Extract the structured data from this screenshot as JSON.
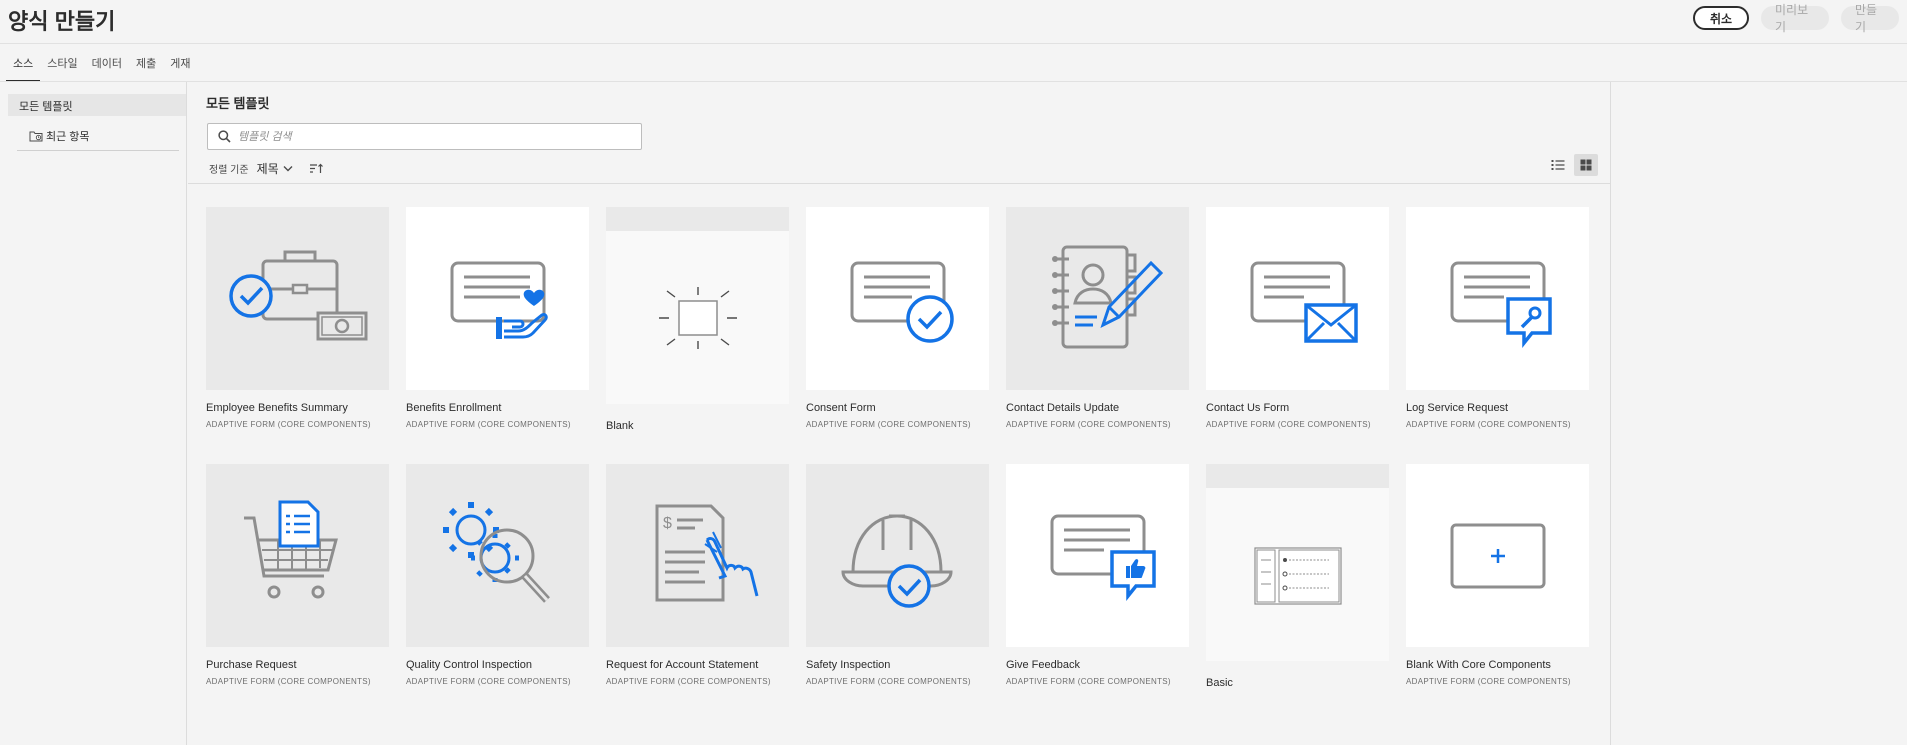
{
  "header": {
    "title": "양식 만들기",
    "cancel_label": "취소",
    "preview_label": "미리보기",
    "create_label": "만들기"
  },
  "tabs": [
    "소스",
    "스타일",
    "데이터",
    "제출",
    "게재"
  ],
  "sidebar": {
    "heading": "모든 템플릿",
    "items": [
      {
        "label": "최근 항목",
        "icon": "folder-recent-icon"
      }
    ]
  },
  "main": {
    "title": "모든 템플릿",
    "search": {
      "placeholder": "템플릿 검색",
      "value": ""
    },
    "sort": {
      "label": "정렬 기준",
      "value": "제목",
      "order_icon": "sort-ascending-icon"
    },
    "view_modes": [
      {
        "name": "list-view-icon",
        "active": false
      },
      {
        "name": "grid-view-icon",
        "active": true
      }
    ],
    "accent": "#1473e6",
    "icon_grey": "#8e8e8e",
    "templates": [
      {
        "title": "Employee Benefits Summary",
        "subtitle": "ADAPTIVE FORM (CORE COMPONENTS)",
        "icon": "briefcase-check-icon"
      },
      {
        "title": "Benefits Enrollment",
        "subtitle": "ADAPTIVE FORM (CORE COMPONENTS)",
        "icon": "form-heart-hand-icon"
      },
      {
        "title": "Blank",
        "subtitle": "",
        "icon": "blank-frame-icon"
      },
      {
        "title": "Consent Form",
        "subtitle": "ADAPTIVE FORM (CORE COMPONENTS)",
        "icon": "form-check-icon"
      },
      {
        "title": "Contact Details Update",
        "subtitle": "ADAPTIVE FORM (CORE COMPONENTS)",
        "icon": "address-book-pen-icon"
      },
      {
        "title": "Contact Us Form",
        "subtitle": "ADAPTIVE FORM (CORE COMPONENTS)",
        "icon": "form-envelope-icon"
      },
      {
        "title": "Log Service Request",
        "subtitle": "ADAPTIVE FORM (CORE COMPONENTS)",
        "icon": "form-wrench-icon"
      },
      {
        "title": "Purchase Request",
        "subtitle": "ADAPTIVE FORM (CORE COMPONENTS)",
        "icon": "cart-document-icon"
      },
      {
        "title": "Quality Control Inspection",
        "subtitle": "ADAPTIVE FORM (CORE COMPONENTS)",
        "icon": "gear-magnifier-icon"
      },
      {
        "title": "Request for Account Statement",
        "subtitle": "ADAPTIVE FORM (CORE COMPONENTS)",
        "icon": "statement-hand-icon"
      },
      {
        "title": "Safety Inspection",
        "subtitle": "ADAPTIVE FORM (CORE COMPONENTS)",
        "icon": "hardhat-check-icon"
      },
      {
        "title": "Give Feedback",
        "subtitle": "ADAPTIVE FORM (CORE COMPONENTS)",
        "icon": "form-thumbsup-icon"
      },
      {
        "title": "Basic",
        "subtitle": "",
        "icon": "basic-layout-icon"
      },
      {
        "title": "Blank With Core Components",
        "subtitle": "ADAPTIVE FORM (CORE COMPONENTS)",
        "icon": "plus-frame-icon"
      }
    ]
  }
}
